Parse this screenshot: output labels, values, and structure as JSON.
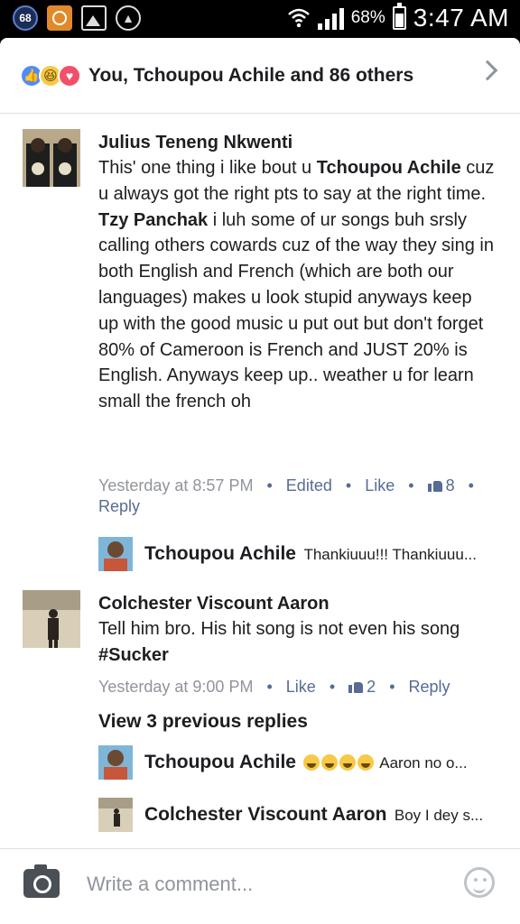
{
  "status_bar": {
    "badge": "68",
    "battery": "68%",
    "time": "3:47 AM"
  },
  "reactions": {
    "summary": "You, Tchoupou Achile and 86 others",
    "icons": [
      "like-reaction",
      "haha-reaction",
      "love-reaction"
    ]
  },
  "comments": [
    {
      "author": "Julius Teneng Nkwenti",
      "body_parts": [
        {
          "text": "This' one thing i like bout u ",
          "bold": false
        },
        {
          "text": "Tchoupou Achile",
          "bold": true
        },
        {
          "text": " cuz u always got the right pts to say at the right time. ",
          "bold": false
        },
        {
          "text": "Tzy Panchak",
          "bold": true
        },
        {
          "text": " i luh some of ur songs buh srsly calling others cowards cuz of the way they sing in both English and French (which are both our languages) makes u look stupid anyways keep up with the good music u put out but don't forget 80% of Cameroon is French and JUST 20% is English. Anyways keep up.. weather u for learn small the french oh",
          "bold": false
        }
      ],
      "time": "Yesterday at 8:57 PM",
      "edited": "Edited",
      "like": "Like",
      "likes": "8",
      "reply": "Reply"
    },
    {
      "author": "Colchester Viscount Aaron",
      "body_parts": [
        {
          "text": "Tell him bro. His hit song is not even his song ",
          "bold": false
        },
        {
          "text": "#Sucker",
          "bold": true
        }
      ],
      "time": "Yesterday at 9:00 PM",
      "like": "Like",
      "likes": "2",
      "reply": "Reply"
    }
  ],
  "replies": [
    {
      "author": "Tchoupou Achile",
      "preview": "Thankiuuu!!! Thankiuuu..."
    },
    {
      "author": "Tchoupou Achile",
      "preview": "Aaron no o..."
    },
    {
      "author": "Colchester Viscount Aaron",
      "preview": "Boy I dey s..."
    }
  ],
  "view_previous": "View 3 previous replies",
  "composer": {
    "placeholder": "Write a comment..."
  }
}
